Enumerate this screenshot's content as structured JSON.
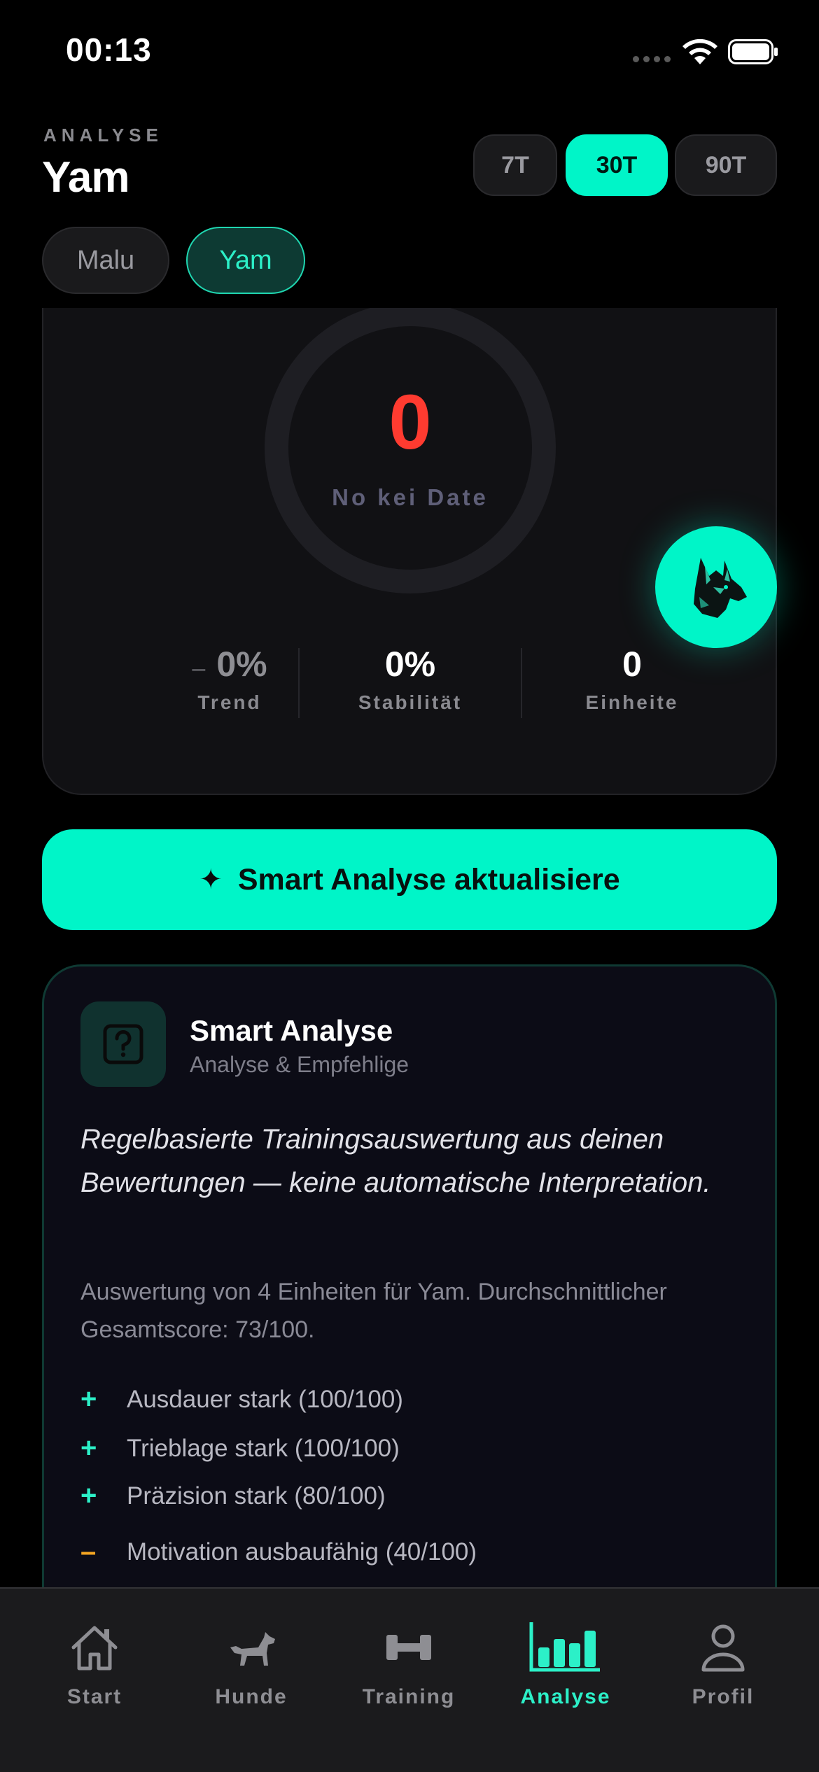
{
  "status_bar": {
    "time": "00:13"
  },
  "header": {
    "kicker": "ANALYSE",
    "title": "Yam",
    "periods": [
      {
        "label": "7T",
        "active": false
      },
      {
        "label": "30T",
        "active": true
      },
      {
        "label": "90T",
        "active": false
      }
    ]
  },
  "dogs": [
    {
      "name": "Malu",
      "active": false
    },
    {
      "name": "Yam",
      "active": true
    }
  ],
  "score": {
    "value": "0",
    "label": "No kei Date",
    "stats": [
      {
        "value": "0%",
        "prefix": "–",
        "label": "Trend"
      },
      {
        "value": "0%",
        "label": "Stabilität"
      },
      {
        "value": "0",
        "label": "Einheite"
      }
    ]
  },
  "cta": {
    "label": "Smart Analyse aktualisiere",
    "icon": "sparkle-icon"
  },
  "analysis": {
    "title": "Smart Analyse",
    "subtitle": "Analyse & Empfehlige",
    "lead": "Regelbasierte Trainingsauswertung aus deinen Bewertungen — keine automatische Interpretation.",
    "summary": "Auswertung von 4 Einheiten für Yam. Durchschnittlicher Gesamtscore: 73/100.",
    "findings": [
      {
        "mark": "+",
        "text": "Ausdauer stark (100/100)"
      },
      {
        "mark": "+",
        "text": "Trieblage stark (100/100)"
      },
      {
        "mark": "+",
        "text": "Präzision stark (80/100)"
      },
      {
        "mark": "–",
        "text": "Motivation ausbaufähig (40/100)"
      }
    ]
  },
  "tabs": [
    {
      "label": "Start",
      "icon": "home-icon",
      "active": false
    },
    {
      "label": "Hunde",
      "icon": "dog-icon",
      "active": false
    },
    {
      "label": "Training",
      "icon": "dumbbell-icon",
      "active": false
    },
    {
      "label": "Analyse",
      "icon": "bar-chart-icon",
      "active": true
    },
    {
      "label": "Profil",
      "icon": "person-icon",
      "active": false
    }
  ],
  "colors": {
    "accent": "#00f5c8",
    "score_red": "#ff3b30",
    "warning": "#f5a623",
    "background": "#000000"
  }
}
